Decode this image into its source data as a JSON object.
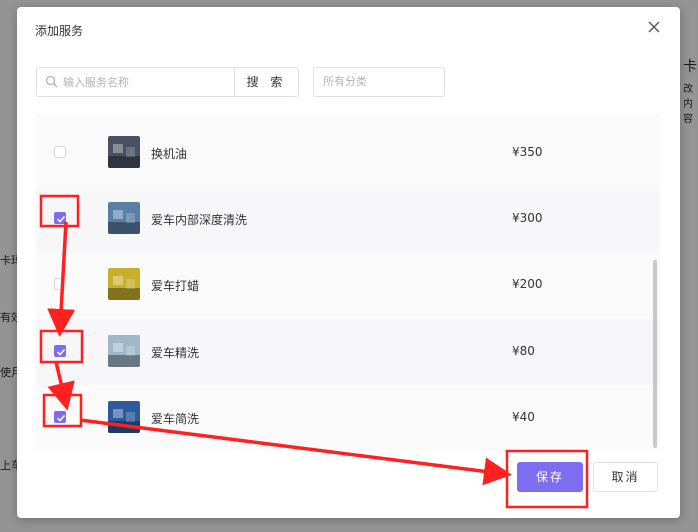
{
  "background": {
    "right_text_1": "卡",
    "right_text_2": "改内容",
    "left_text_1": "卡玛",
    "left_text_2": "有效",
    "left_text_3": "使月",
    "left_text_4": "上车"
  },
  "dialog": {
    "title": "添加服务",
    "close_icon": "close-icon"
  },
  "toolbar": {
    "search_placeholder": "输入服务名称",
    "search_value": "",
    "search_button": "搜 索",
    "category_placeholder": "所有分类"
  },
  "services": [
    {
      "name": "换机油",
      "price": "¥350",
      "checked": false,
      "thumb_color": "#4a4f63"
    },
    {
      "name": "爱车内部深度清洗",
      "price": "¥300",
      "checked": true,
      "thumb_color": "#5a7fa5"
    },
    {
      "name": "爱车打蜡",
      "price": "¥200",
      "checked": false,
      "thumb_color": "#c8b02a"
    },
    {
      "name": "爱车精洗",
      "price": "¥80",
      "checked": true,
      "thumb_color": "#9fb8c9"
    },
    {
      "name": "爱车简洗",
      "price": "¥40",
      "checked": true,
      "thumb_color": "#2f5a9e"
    }
  ],
  "footer": {
    "save_label": "保存",
    "cancel_label": "取消"
  },
  "colors": {
    "accent": "#7d6df0",
    "annotation": "#ff2020"
  }
}
